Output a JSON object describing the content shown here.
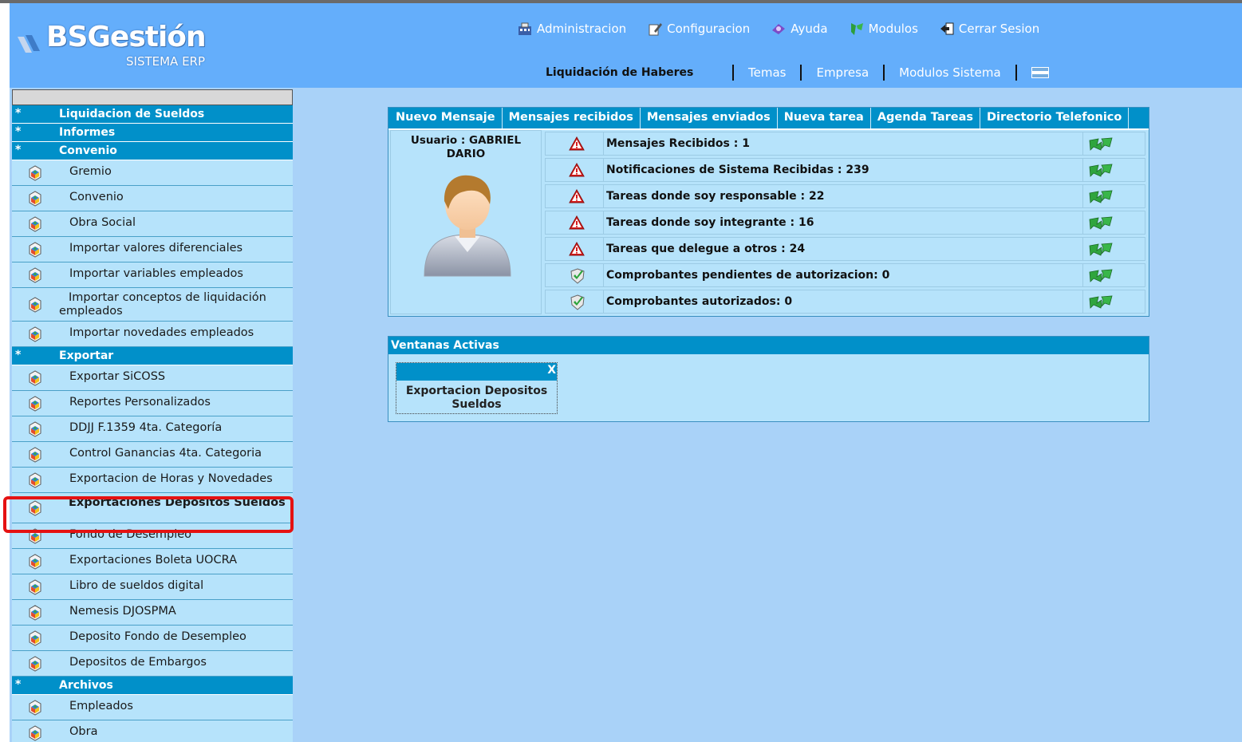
{
  "header": {
    "logo_text": "BSGestión",
    "logo_subtitle": "SISTEMA ERP",
    "top_menu": [
      {
        "label": "Administracion",
        "icon": "admin-icon"
      },
      {
        "label": "Configuracion",
        "icon": "config-icon"
      },
      {
        "label": "Ayuda",
        "icon": "help-icon"
      },
      {
        "label": "Modulos",
        "icon": "modules-icon"
      },
      {
        "label": "Cerrar Sesion",
        "icon": "logout-icon"
      }
    ],
    "module_name": "Liquidación de Haberes",
    "sub_links": [
      "Temas",
      "Empresa",
      "Modulos Sistema"
    ],
    "flag_icon": "argentina-flag-icon"
  },
  "sidebar": {
    "sections": [
      {
        "title": "Liquidacion de Sueldos",
        "star": "*",
        "items": []
      },
      {
        "title": "Informes",
        "star": "*",
        "items": []
      },
      {
        "title": "Convenio",
        "star": "*",
        "items": [
          "Gremio",
          "Convenio",
          "Obra Social",
          "Importar valores diferenciales",
          "Importar variables empleados",
          "Importar conceptos de liquidación empleados",
          "Importar novedades empleados"
        ]
      },
      {
        "title": "Exportar",
        "star": "*",
        "items": [
          "Exportar SiCOSS",
          "Reportes Personalizados",
          "DDJJ F.1359 4ta. Categoría",
          "Control Ganancias 4ta. Categoria",
          "Exportacion de Horas y Novedades",
          "Exportaciones Depositos Sueldos",
          "Fondo de Desempleo",
          "Exportaciones Boleta UOCRA",
          "Libro de sueldos digital",
          "Nemesis DJOSPMA",
          "Deposito Fondo de Desempleo",
          "Depositos de Embargos"
        ]
      },
      {
        "title": "Archivos",
        "star": "*",
        "items": [
          "Empleados",
          "Obra"
        ]
      }
    ]
  },
  "dashboard": {
    "tabs": [
      "Nuevo Mensaje",
      "Mensajes recibidos",
      "Mensajes enviados",
      "Nueva tarea",
      "Agenda Tareas",
      "Directorio Telefonico"
    ],
    "user_label": "Usuario : GABRIEL DARIO",
    "rows": [
      {
        "text": "Mensajes Recibidos : 1",
        "status": "warning"
      },
      {
        "text": "Notificaciones de Sistema Recibidas : 239",
        "status": "warning"
      },
      {
        "text": "Tareas donde soy responsable : 22",
        "status": "warning"
      },
      {
        "text": "Tareas donde soy integrante : 16",
        "status": "warning"
      },
      {
        "text": "Tareas que delegue a otros : 24",
        "status": "warning"
      },
      {
        "text": "Comprobantes pendientes de autorizacion: 0",
        "status": "ok"
      },
      {
        "text": "Comprobantes autorizados: 0",
        "status": "ok"
      }
    ]
  },
  "active_windows": {
    "title": "Ventanas Activas",
    "windows": [
      {
        "label": "Exportacion Depositos Sueldos",
        "close": "X"
      }
    ]
  },
  "colors": {
    "header": "#64aefb",
    "accent": "#0190c9",
    "row_bg": "#b6e3fb",
    "highlight": "#e51212"
  }
}
